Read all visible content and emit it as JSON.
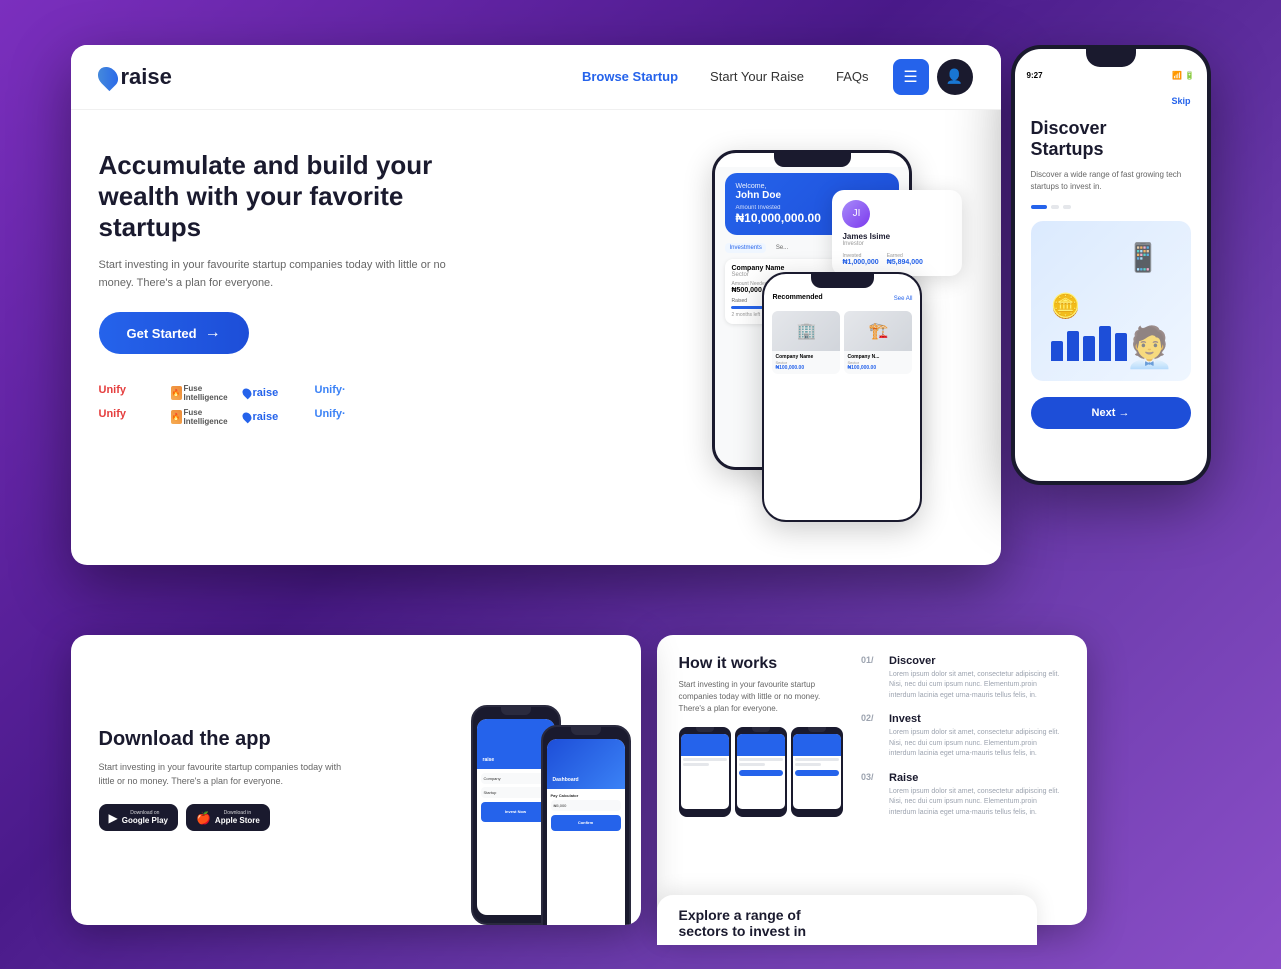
{
  "app": {
    "name": "raise",
    "background_gradient": "linear-gradient(135deg, #7b2fbe, #4a1a8a, #6a3aaa)"
  },
  "navbar": {
    "logo": "raise",
    "links": [
      {
        "label": "Browse Startup",
        "active": true
      },
      {
        "label": "Start Your Raise",
        "active": false
      },
      {
        "label": "FAQs",
        "active": false
      }
    ],
    "menu_icon": "☰",
    "user_icon": "👤"
  },
  "hero": {
    "title": "Accumulate and build your wealth with your favorite startups",
    "subtitle": "Start investing in your favourite startup companies today with little or no money. There's a plan for everyone.",
    "cta_button": "Get Started",
    "cta_arrow": "→"
  },
  "brands": [
    {
      "name": "Unify",
      "type": "unify-red"
    },
    {
      "name": "Fuse Intelligence",
      "type": "fi"
    },
    {
      "name": "raise",
      "type": "raise"
    },
    {
      "name": "Unify",
      "type": "unify-blue"
    },
    {
      "name": "Unify",
      "type": "unify-red"
    },
    {
      "name": "Fuse Intelligence",
      "type": "fi"
    },
    {
      "name": "raise",
      "type": "raise"
    },
    {
      "name": "Unify",
      "type": "unify-blue"
    }
  ],
  "phone_dashboard": {
    "welcome_text": "Welcome,",
    "user_name": "John Doe",
    "amount_label": "Amount Invested",
    "amount": "₦10,000,000.00",
    "tabs": [
      "Investments",
      "Se..."
    ],
    "company": {
      "name": "Company Name",
      "sector": "Sector",
      "amount_needed_label": "Amount Needed",
      "amount_needed": "₦500,000,000.00",
      "raised_label": "Raised",
      "progress": 20,
      "time_left": "2 months left"
    }
  },
  "investor_card": {
    "name": "James Isime",
    "role": "Investor",
    "invested_label": "Invested",
    "invested_value": "₦1,000,000",
    "earned_label": "Earned",
    "earned_value": "₦5,894,000"
  },
  "phone_recommended": {
    "title": "Recommended",
    "see_all": "See All",
    "companies": [
      {
        "name": "Company Name",
        "sector": "Sector",
        "amount": "₦100,000.00"
      },
      {
        "name": "Company N...",
        "sector": "Sector",
        "amount": "₦100,000.00"
      }
    ]
  },
  "right_phone": {
    "time": "9:27",
    "skip_label": "Skip",
    "title": "Discover\nStartups",
    "subtitle": "Discover a wide range of fast growing tech startups to invest in.",
    "dots": [
      true,
      false,
      false
    ],
    "next_button": "Next →"
  },
  "download_section": {
    "title": "Download the app",
    "subtitle": "Start investing in your favourite startup companies today with little or no money. There's a plan for everyone.",
    "google_play_top": "Download on",
    "google_play_main": "Google Play",
    "apple_store_top": "Download in",
    "apple_store_main": "Apple Store"
  },
  "how_it_works": {
    "title": "How it works",
    "subtitle": "Start investing in your favourite startup companies today with little or no money. There's a plan for everyone.",
    "steps": [
      {
        "num": "01/",
        "title": "Discover",
        "desc": "Lorem ipsum dolor sit amet, consectetur adipiscing elit. Nisi, nec dui cum ipsum nunc. Elementum.proin interdum lacinia eget urna-mauris tellus felis, in."
      },
      {
        "num": "02/",
        "title": "Invest",
        "desc": "Lorem ipsum dolor sit amet, consectetur adipiscing elit. Nisi, nec dui cum ipsum nunc. Elementum.proin interdum lacinia eget urna-mauris tellus felis, in."
      },
      {
        "num": "03/",
        "title": "Raise",
        "desc": "Lorem ipsum dolor sit amet, consectetur adipiscing elit. Nisi, nec dui cum ipsum nunc. Elementum.proin interdum lacinia eget urna-mauris tellus felis, in."
      }
    ]
  },
  "explore": {
    "title": "Explore a range of sectors to invest in"
  }
}
